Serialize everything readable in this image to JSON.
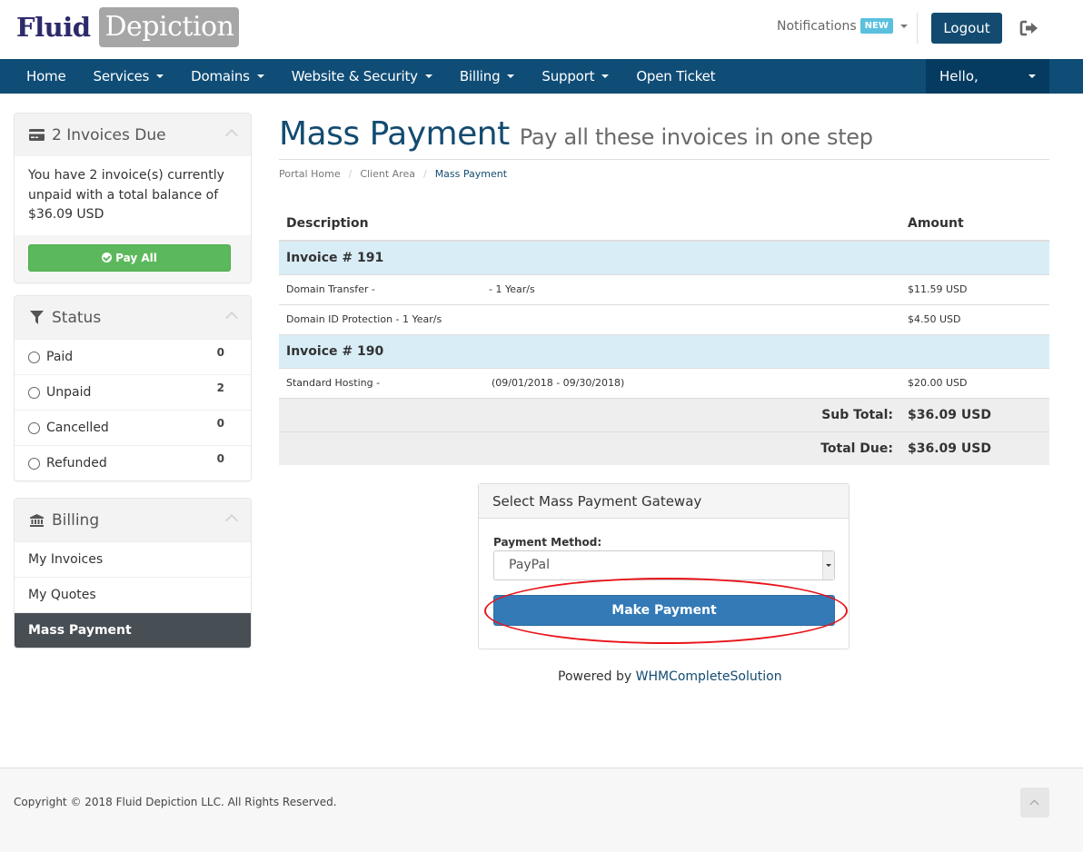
{
  "header": {
    "logo_part1": "Fluid",
    "logo_part2": "Depiction",
    "notifications_label": "Notifications",
    "notifications_badge": "NEW",
    "logout_label": "Logout",
    "signout_icon": "sign-out-icon"
  },
  "nav": {
    "items": [
      {
        "label": "Home",
        "dropdown": false
      },
      {
        "label": "Services",
        "dropdown": true
      },
      {
        "label": "Domains",
        "dropdown": true
      },
      {
        "label": "Website & Security",
        "dropdown": true
      },
      {
        "label": "Billing",
        "dropdown": true
      },
      {
        "label": "Support",
        "dropdown": true
      },
      {
        "label": "Open Ticket",
        "dropdown": false
      }
    ],
    "user_greeting": "Hello,"
  },
  "sidebar": {
    "invoices_due": {
      "title": "2 Invoices Due",
      "icon": "credit-card-icon",
      "message": "You have 2 invoice(s) currently unpaid with a total balance of $36.09 USD",
      "pay_all_label": "Pay All"
    },
    "status": {
      "title": "Status",
      "icon": "filter-icon",
      "items": [
        {
          "label": "Paid",
          "count": "0"
        },
        {
          "label": "Unpaid",
          "count": "2"
        },
        {
          "label": "Cancelled",
          "count": "0"
        },
        {
          "label": "Refunded",
          "count": "0"
        }
      ]
    },
    "billing": {
      "title": "Billing",
      "icon": "bank-icon",
      "items": [
        {
          "label": "My Invoices",
          "active": false
        },
        {
          "label": "My Quotes",
          "active": false
        },
        {
          "label": "Mass Payment",
          "active": true
        }
      ]
    }
  },
  "main": {
    "title": "Mass Payment",
    "subtitle": "Pay all these invoices in one step",
    "breadcrumb": [
      "Portal Home",
      "Client Area",
      "Mass Payment"
    ],
    "table": {
      "headers": {
        "description": "Description",
        "amount": "Amount"
      },
      "invoices": [
        {
          "title": "Invoice # 191",
          "items": [
            {
              "desc": "Domain Transfer -",
              "detail": "- 1 Year/s",
              "amount": "$11.59 USD"
            },
            {
              "desc": "Domain ID Protection - 1 Year/s",
              "detail": "",
              "amount": "$4.50 USD"
            }
          ]
        },
        {
          "title": "Invoice # 190",
          "items": [
            {
              "desc": "Standard Hosting -",
              "detail": "(09/01/2018 - 09/30/2018)",
              "amount": "$20.00 USD"
            }
          ]
        }
      ],
      "subtotal_label": "Sub Total:",
      "subtotal_value": "$36.09 USD",
      "total_label": "Total Due:",
      "total_value": "$36.09 USD"
    },
    "gateway": {
      "title": "Select Mass Payment Gateway",
      "method_label": "Payment Method:",
      "selected_method": "PayPal",
      "make_payment_label": "Make Payment"
    },
    "powered_by_prefix": "Powered by",
    "powered_by_link": "WHMCompleteSolution"
  },
  "footer": {
    "copyright": "Copyright © 2018 Fluid Depiction LLC. All Rights Reserved."
  }
}
